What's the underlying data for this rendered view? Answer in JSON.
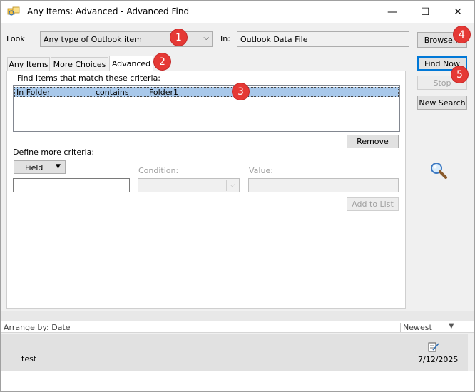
{
  "window": {
    "title": "Any Items: Advanced - Advanced Find",
    "min_glyph": "—",
    "max_glyph": "☐",
    "close_glyph": "✕"
  },
  "look": {
    "label": "Look",
    "value": "Any type of Outlook item",
    "in_label": "In:",
    "in_value": "Outlook Data File",
    "browse_label": "Browse..."
  },
  "actions": {
    "find_now": "Find Now",
    "stop": "Stop",
    "new_search": "New Search"
  },
  "tabs": [
    {
      "label": "Any Items"
    },
    {
      "label": "More Choices"
    },
    {
      "label": "Advanced",
      "active": true
    }
  ],
  "advanced": {
    "criteria_heading": "Find items that match these criteria:",
    "criteria": [
      {
        "field": "In Folder",
        "condition": "contains",
        "value": "Folder1"
      }
    ],
    "remove_label": "Remove",
    "define_more": "Define more criteria:",
    "field_label": "Field",
    "condition_label": "Condition:",
    "value_label": "Value:",
    "add_to_list": "Add to List"
  },
  "results": {
    "arrange_by": "Arrange by: Date",
    "sort": "Newest",
    "rows": [
      {
        "subject": "test",
        "date": "7/12/2025"
      }
    ]
  },
  "callouts": [
    "1",
    "2",
    "3",
    "4",
    "5"
  ],
  "colors": {
    "accent": "#0078d7",
    "selection": "#a8c8ea",
    "callout": "#e53935"
  }
}
